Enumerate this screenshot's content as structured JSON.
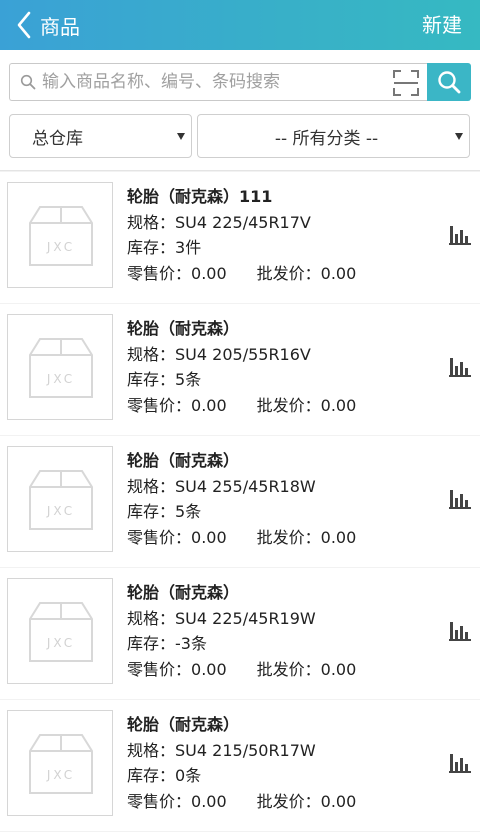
{
  "header": {
    "title": "商品",
    "new_label": "新建"
  },
  "search": {
    "placeholder": "输入商品名称、编号、条码搜索",
    "value": ""
  },
  "filters": {
    "warehouse": "总仓库",
    "category": "-- 所有分类 --"
  },
  "labels": {
    "spec": "规格：",
    "stock": "库存：",
    "retail": "零售价：",
    "wholesale": "批发价："
  },
  "thumb_text": "JXC",
  "colors": {
    "header_start": "#3aa1d6",
    "header_end": "#36b9c2",
    "accent": "#3bb6c6"
  },
  "products": [
    {
      "name": "轮胎（耐克森）111",
      "spec": "SU4 225/45R17V",
      "stock": "3件",
      "retail": "0.00",
      "wholesale": "0.00"
    },
    {
      "name": "轮胎（耐克森）",
      "spec": "SU4 205/55R16V",
      "stock": "5条",
      "retail": "0.00",
      "wholesale": "0.00"
    },
    {
      "name": "轮胎（耐克森）",
      "spec": "SU4 255/45R18W",
      "stock": "5条",
      "retail": "0.00",
      "wholesale": "0.00"
    },
    {
      "name": "轮胎（耐克森）",
      "spec": "SU4 225/45R19W",
      "stock": "-3条",
      "retail": "0.00",
      "wholesale": "0.00"
    },
    {
      "name": "轮胎（耐克森）",
      "spec": "SU4 215/50R17W",
      "stock": "0条",
      "retail": "0.00",
      "wholesale": "0.00"
    }
  ]
}
